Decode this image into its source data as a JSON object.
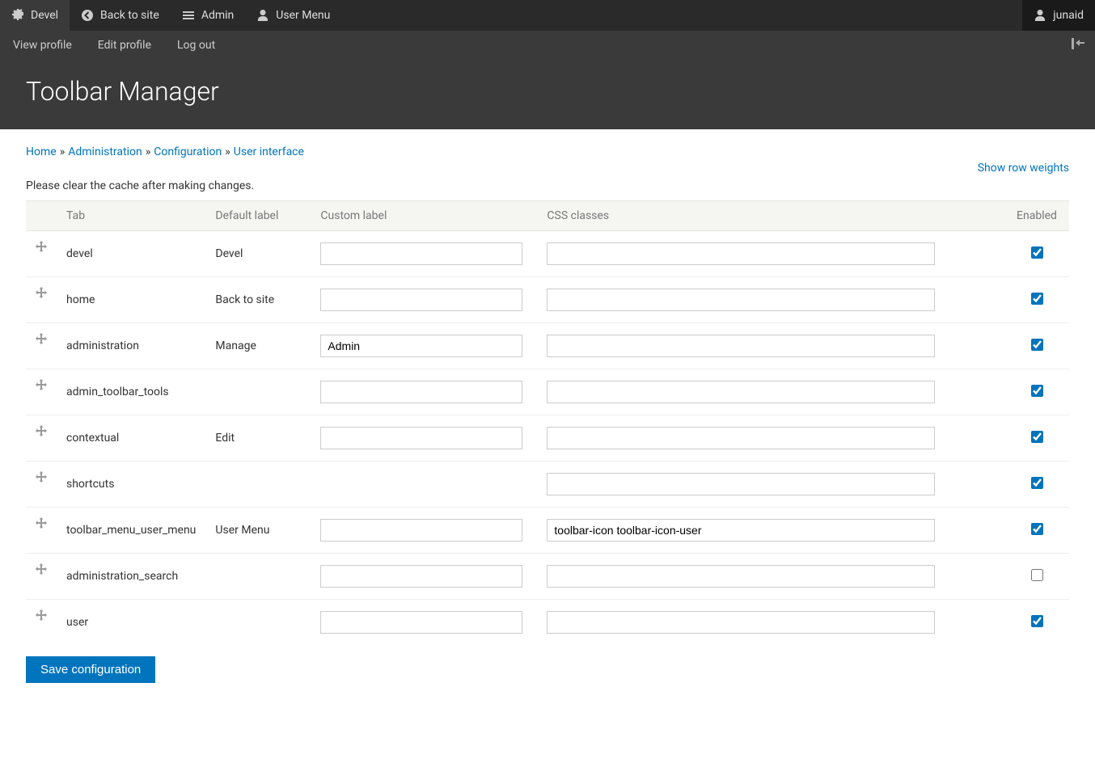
{
  "toolbar": {
    "items": [
      {
        "label": "Devel",
        "icon": "gear"
      },
      {
        "label": "Back to site",
        "icon": "back"
      },
      {
        "label": "Admin",
        "icon": "menu"
      },
      {
        "label": "User Menu",
        "icon": "user"
      }
    ],
    "user": {
      "label": "junaid",
      "icon": "user"
    }
  },
  "subtoolbar": {
    "items": [
      {
        "label": "View profile"
      },
      {
        "label": "Edit profile"
      },
      {
        "label": "Log out"
      }
    ]
  },
  "header": {
    "title": "Toolbar Manager"
  },
  "breadcrumb": {
    "items": [
      "Home",
      "Administration",
      "Configuration",
      "User interface"
    ],
    "sep": "»"
  },
  "weights_link": "Show row weights",
  "notice": "Please clear the cache after making changes.",
  "table": {
    "headers": {
      "tab": "Tab",
      "default": "Default label",
      "custom": "Custom label",
      "css": "CSS classes",
      "enabled": "Enabled"
    },
    "rows": [
      {
        "tab": "devel",
        "default": "Devel",
        "custom": "",
        "css": "",
        "enabled": true,
        "show_custom": true
      },
      {
        "tab": "home",
        "default": "Back to site",
        "custom": "",
        "css": "",
        "enabled": true,
        "show_custom": true
      },
      {
        "tab": "administration",
        "default": "Manage",
        "custom": "Admin",
        "css": "",
        "enabled": true,
        "show_custom": true
      },
      {
        "tab": "admin_toolbar_tools",
        "default": "",
        "custom": "",
        "css": "",
        "enabled": true,
        "show_custom": true
      },
      {
        "tab": "contextual",
        "default": "Edit",
        "custom": "",
        "css": "",
        "enabled": true,
        "show_custom": true
      },
      {
        "tab": "shortcuts",
        "default": "",
        "custom": "",
        "css": "",
        "enabled": true,
        "show_custom": false
      },
      {
        "tab": "toolbar_menu_user_menu",
        "default": "User Menu",
        "custom": "",
        "css": "toolbar-icon toolbar-icon-user",
        "enabled": true,
        "show_custom": true
      },
      {
        "tab": "administration_search",
        "default": "",
        "custom": "",
        "css": "",
        "enabled": false,
        "show_custom": true
      },
      {
        "tab": "user",
        "default": "",
        "custom": "",
        "css": "",
        "enabled": true,
        "show_custom": true
      }
    ]
  },
  "save_button": "Save configuration"
}
